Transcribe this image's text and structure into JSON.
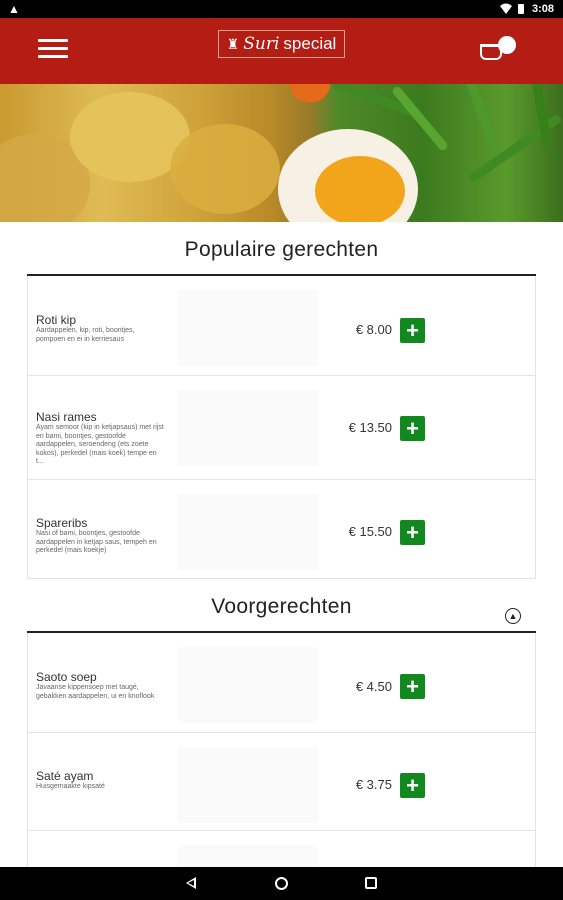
{
  "statusbar": {
    "warning_glyph": "▲",
    "time": "3:08"
  },
  "header": {
    "logo_script": "Suri",
    "logo_text": "special",
    "menu_icon": "hamburger-menu-icon",
    "cart_icon": "shopping-basket-icon"
  },
  "colors": {
    "brand_red": "#b41d14",
    "add_green": "#12891f",
    "text": "#222222"
  },
  "sections": [
    {
      "title": "Populaire gerechten",
      "items": [
        {
          "name": "Roti kip",
          "description": "Aardappelen, kip, roti, boontjes, pompoen en ei in kerriesaus",
          "price": "€ 8.00",
          "add_label": "+"
        },
        {
          "name": "Nasi rames",
          "description": "Ayam semoor (kip in ketjapsaus) met rijst en bami, boontjes, gestoofde aardappelen, seroendeng (ets zoete kokos), perkedel (mais koek) tempe en t...",
          "price": "€ 13.50",
          "add_label": "+"
        },
        {
          "name": "Spareribs",
          "description": "Nasi of bami, boontjes, gestoofde aardappelen in ketjap saus, tempeh en perkedel (mais koekje)",
          "price": "€ 15.50",
          "add_label": "+"
        }
      ]
    },
    {
      "title": "Voorgerechten",
      "collapse_icon": "chevron-up-circle-icon",
      "collapse_glyph": "▲",
      "items": [
        {
          "name": "Saoto soep",
          "description": "Javaanse kippensoep met taugé, gebakken aardappelen, ui en knoflook",
          "price": "€ 4.50",
          "add_label": "+"
        },
        {
          "name": "Saté ayam",
          "description": "Huisgemaakte kipsaté",
          "price": "€ 3.75",
          "add_label": "+"
        }
      ]
    }
  ],
  "navbar": {
    "back_icon": "back-triangle-icon",
    "home_icon": "home-circle-icon",
    "recent_icon": "recent-apps-square-icon"
  }
}
